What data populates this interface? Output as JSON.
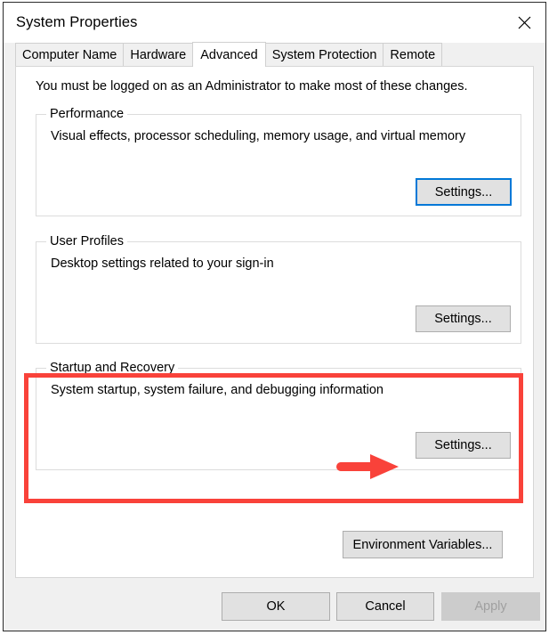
{
  "window": {
    "title": "System Properties",
    "close_icon": "close-icon"
  },
  "tabs": [
    {
      "label": "Computer Name",
      "active": false
    },
    {
      "label": "Hardware",
      "active": false
    },
    {
      "label": "Advanced",
      "active": true
    },
    {
      "label": "System Protection",
      "active": false
    },
    {
      "label": "Remote",
      "active": false
    }
  ],
  "content": {
    "admin_note": "You must be logged on as an Administrator to make most of these changes.",
    "groups": [
      {
        "legend": "Performance",
        "description": "Visual effects, processor scheduling, memory usage, and virtual memory",
        "button_label": "Settings..."
      },
      {
        "legend": "User Profiles",
        "description": "Desktop settings related to your sign-in",
        "button_label": "Settings..."
      },
      {
        "legend": "Startup and Recovery",
        "description": "System startup, system failure, and debugging information",
        "button_label": "Settings..."
      }
    ],
    "environment_variables_label": "Environment Variables..."
  },
  "footer": {
    "ok_label": "OK",
    "cancel_label": "Cancel",
    "apply_label": "Apply"
  },
  "annotation": {
    "highlight_color": "#f9423a",
    "arrow_name": "red-arrow-pointing-to-startup-recovery-settings"
  },
  "colors": {
    "focus_border": "#0078d7",
    "annotation": "#f9423a",
    "dialog_bg": "#f0f0f0",
    "panel_bg": "#ffffff"
  }
}
